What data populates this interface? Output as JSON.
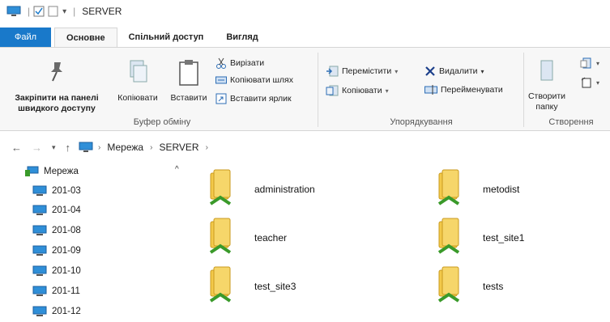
{
  "window": {
    "title": "SERVER"
  },
  "ribbon_tabs": [
    {
      "label": "Файл"
    },
    {
      "label": "Основне"
    },
    {
      "label": "Спільний доступ"
    },
    {
      "label": "Вигляд"
    }
  ],
  "clipboard": {
    "pin_label_1": "Закріпити на панелі",
    "pin_label_2": "швидкого доступу",
    "copy_label": "Копіювати",
    "paste_label": "Вставити",
    "cut_label": "Вирізати",
    "copy_path_label": "Копіювати шлях",
    "paste_shortcut_label": "Вставити ярлик",
    "group_label": "Буфер обміну"
  },
  "organize": {
    "move_label": "Перемістити",
    "copy_to_label": "Копіювати",
    "delete_label": "Видалити",
    "rename_label": "Перейменувати",
    "group_label": "Упорядкування"
  },
  "new_group": {
    "create_label_1": "Створити",
    "create_label_2": "папку",
    "group_label": "Створення"
  },
  "address": {
    "crumbs": [
      "Мережа",
      "SERVER"
    ]
  },
  "nav_pane": {
    "root": "Мережа",
    "items": [
      "201-03",
      "201-04",
      "201-08",
      "201-09",
      "201-10",
      "201-11",
      "201-12"
    ]
  },
  "folders": [
    {
      "name": "administration"
    },
    {
      "name": "metodist"
    },
    {
      "name": "teacher"
    },
    {
      "name": "test_site1"
    },
    {
      "name": "test_site3"
    },
    {
      "name": "tests"
    }
  ],
  "colors": {
    "accent": "#1979ca",
    "folder_yellow": "#f3c94a",
    "share_green": "#3a9a2a",
    "computer_blue": "#2f8fd8"
  }
}
